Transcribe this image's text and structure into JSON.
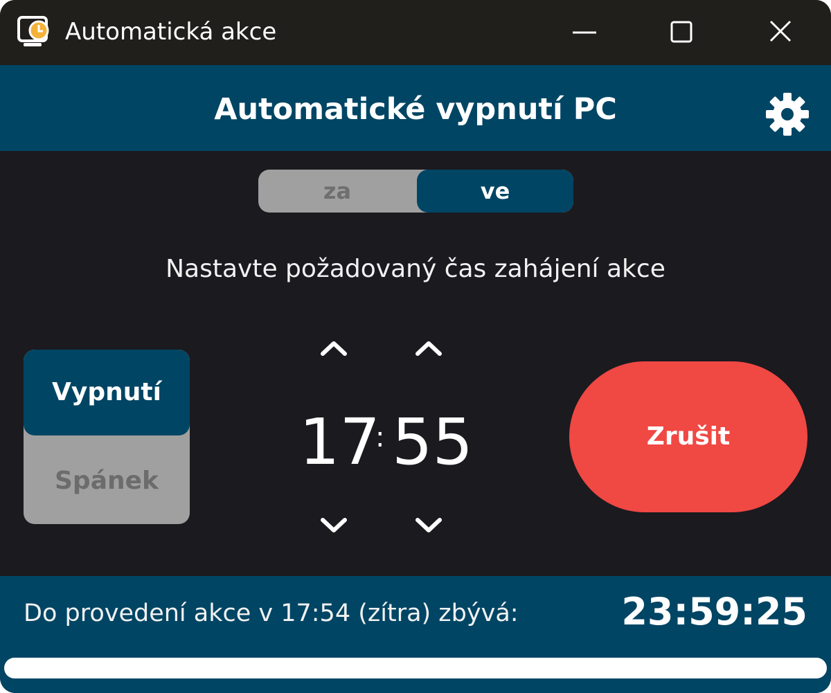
{
  "window": {
    "title": "Automatická akce",
    "minimize_icon": "minimize-icon",
    "maximize_icon": "maximize-icon",
    "close_icon": "close-icon"
  },
  "header": {
    "title": "Automatické vypnutí PC",
    "settings_icon": "gear-icon"
  },
  "mode_toggle": {
    "options": [
      "za",
      "ve"
    ],
    "selected": "ve"
  },
  "instruction": "Nastavte požadovaný čas zahájení akce",
  "action": {
    "options": [
      "Vypnutí",
      "Spánek"
    ],
    "selected": "Vypnutí"
  },
  "time": {
    "hours": "17",
    "separator": ":",
    "minutes": "55"
  },
  "cancel_label": "Zrušit",
  "footer": {
    "status": "Do provedení akce v 17:54 (zítra) zbývá:",
    "countdown": "23:59:25",
    "progress": 1.0
  },
  "colors": {
    "accent": "#004564",
    "cancel": "#f04843",
    "background": "#1b1a1f",
    "titlebar": "#211f1c"
  }
}
